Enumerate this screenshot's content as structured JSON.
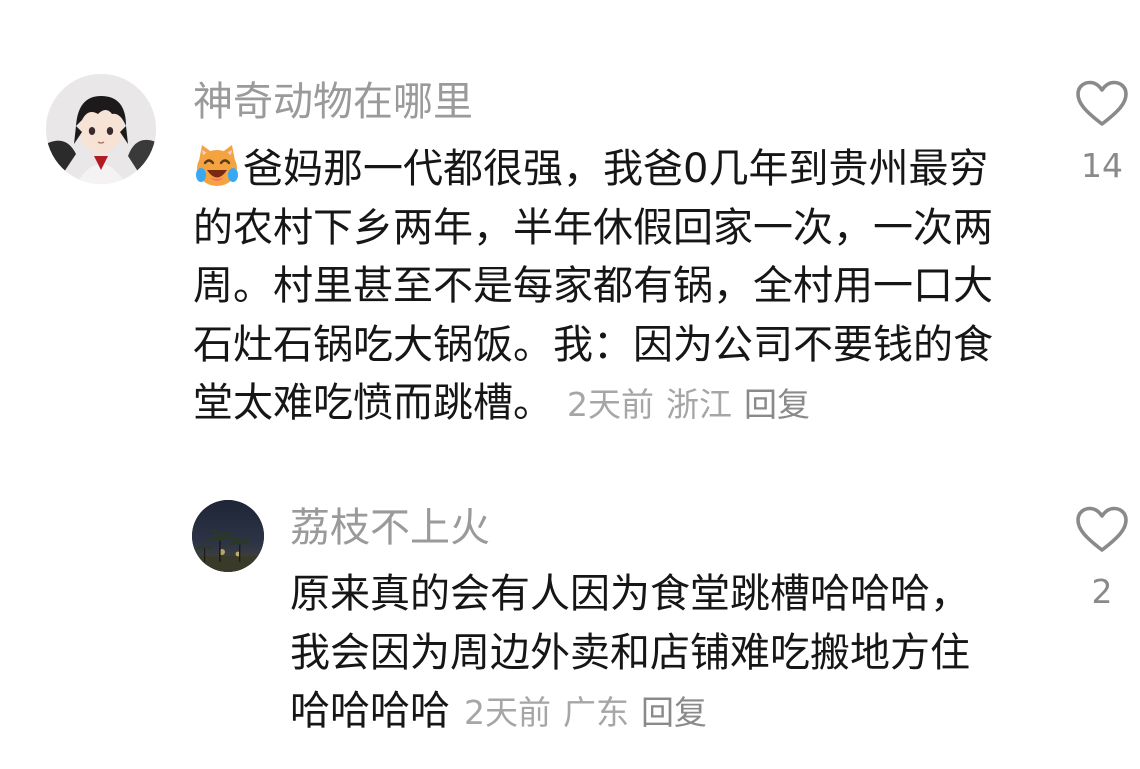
{
  "comments": [
    {
      "username": "神奇动物在哪里",
      "emoji": "laughing-crying-cat-emoji",
      "text": "爸妈那一代都很强，我爸0几年到贵州最穷的农村下乡两年，半年休假回家一次，一次两周。村里甚至不是每家都有锅，全村用一口大石灶石锅吃大锅饭。我：因为公司不要钱的食堂太难吃愤而跳槽。",
      "time": "2天前",
      "location": "浙江",
      "reply_label": "回复",
      "like_count": "14"
    },
    {
      "username": "荔枝不上火",
      "text": "原来真的会有人因为食堂跳槽哈哈哈，我会因为周边外卖和店铺难吃搬地方住哈哈哈哈",
      "time": "2天前",
      "location": "广东",
      "reply_label": "回复",
      "like_count": "2"
    }
  ],
  "colors": {
    "username": "#9a9a9a",
    "body_text": "#161616",
    "meta": "#a6a6a6",
    "icon": "#8a8a8a"
  }
}
